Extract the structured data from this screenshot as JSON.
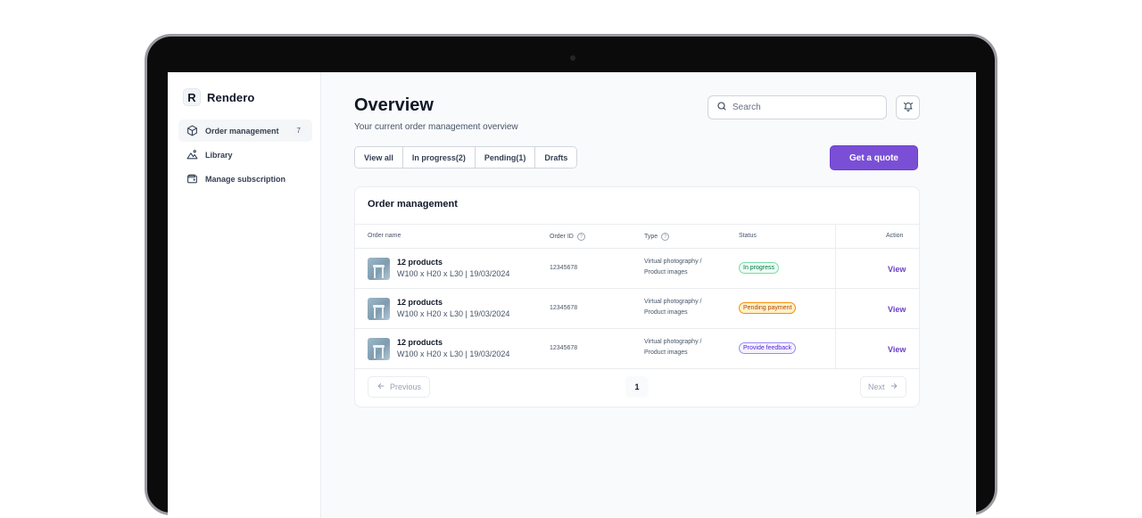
{
  "app": {
    "name": "Rendero",
    "logo_letter": "R"
  },
  "sidebar": {
    "items": [
      {
        "label": "Order management",
        "icon": "cube-icon",
        "count": "7",
        "active": true
      },
      {
        "label": "Library",
        "icon": "image-library-icon"
      },
      {
        "label": "Manage subscription",
        "icon": "wallet-icon"
      }
    ]
  },
  "header": {
    "title": "Overview",
    "subtitle": "Your current order management overview",
    "search_placeholder": "Search",
    "notification_icon": "bell-icon"
  },
  "tabs": [
    "View all",
    "In progress(2)",
    "Pending(1)",
    "Drafts"
  ],
  "actions": {
    "quote_label": "Get a quote"
  },
  "table": {
    "title": "Order management",
    "columns": {
      "order_name": "Order name",
      "order_id": "Order ID",
      "type": "Type",
      "status": "Status",
      "action": "Action"
    },
    "rows": [
      {
        "name": "12 products",
        "details": "W100 x H20 x L30 | 19/03/2024",
        "order_id": "12345678",
        "type_line1": "Virtual photography /",
        "type_line2": "Product images",
        "status": "In progress",
        "action": "View"
      },
      {
        "name": "12 products",
        "details": "W100 x H20 x L30 | 19/03/2024",
        "order_id": "12345678",
        "type_line1": "Virtual photography /",
        "type_line2": "Product images",
        "status": "Pending payment",
        "action": "View"
      },
      {
        "name": "12 products",
        "details": "W100 x H20 x L30 | 19/03/2024",
        "order_id": "12345678",
        "type_line1": "Virtual photography /",
        "type_line2": "Product images",
        "status": "Provide feedback",
        "action": "View"
      }
    ]
  },
  "pagination": {
    "previous": "Previous",
    "current_page": "1",
    "next": "Next"
  },
  "colors": {
    "accent": "#7a4fd6",
    "status_in_progress": "#067647",
    "status_pending": "#b54708",
    "status_feedback": "#5925dc"
  }
}
